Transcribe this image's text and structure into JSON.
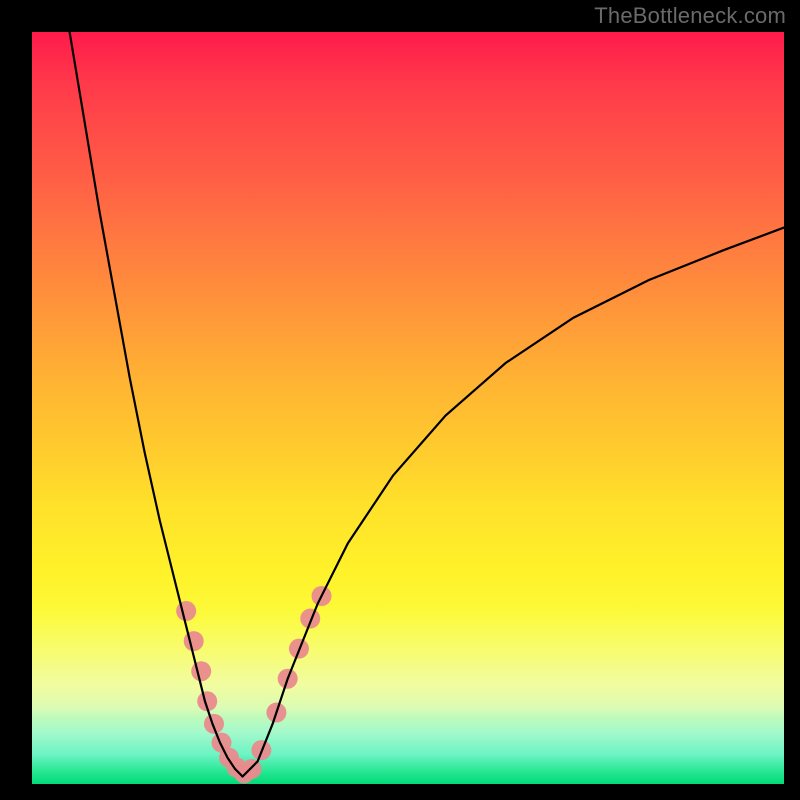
{
  "watermark": "TheBottleneck.com",
  "chart_data": {
    "type": "line",
    "title": "",
    "xlabel": "",
    "ylabel": "",
    "xlim": [
      0,
      100
    ],
    "ylim": [
      0,
      100
    ],
    "series": [
      {
        "name": "left-curve",
        "x": [
          5,
          7,
          9,
          11,
          13,
          15,
          17,
          19,
          21,
          23,
          24,
          25,
          26,
          27,
          28
        ],
        "y": [
          100,
          88,
          76,
          65,
          54,
          44,
          35,
          27,
          19,
          11,
          8,
          5.5,
          3.5,
          2,
          1
        ]
      },
      {
        "name": "right-curve",
        "x": [
          28,
          30,
          32,
          34,
          36,
          38,
          42,
          48,
          55,
          63,
          72,
          82,
          92,
          100
        ],
        "y": [
          1,
          3,
          8,
          14,
          19,
          24,
          32,
          41,
          49,
          56,
          62,
          67,
          71,
          74
        ]
      }
    ],
    "highlights": {
      "name": "pink-dots",
      "x": [
        20.5,
        21.5,
        22.5,
        23.3,
        24.2,
        25.2,
        26.2,
        27.2,
        28.2,
        29.2,
        30.5,
        32.5,
        34.0,
        35.5,
        37.0,
        38.5
      ],
      "y": [
        23,
        19,
        15,
        11,
        8,
        5.5,
        3.5,
        2.2,
        1.4,
        2.0,
        4.5,
        9.5,
        14,
        18,
        22,
        25
      ]
    },
    "gradient_stops": [
      {
        "pos": 0.0,
        "color": "#ff1a4b"
      },
      {
        "pos": 0.5,
        "color": "#ffd62c"
      },
      {
        "pos": 0.8,
        "color": "#fcfb3b"
      },
      {
        "pos": 1.0,
        "color": "#00db78"
      }
    ]
  }
}
